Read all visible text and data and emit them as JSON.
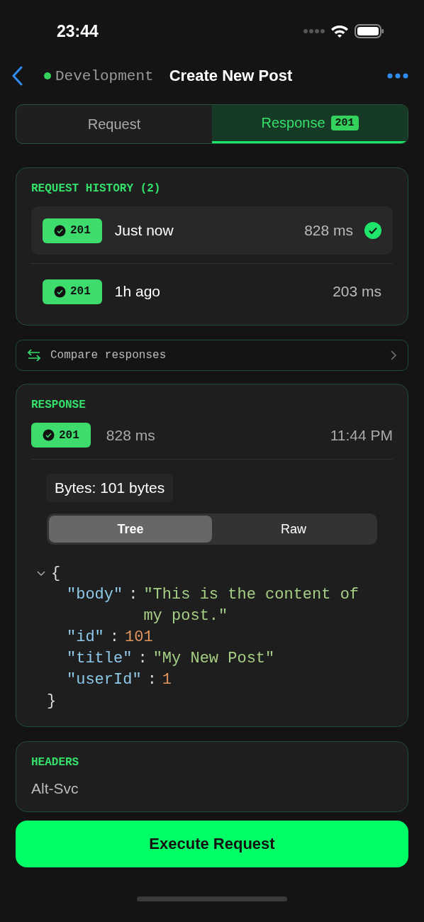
{
  "status_bar": {
    "time": "23:44"
  },
  "nav": {
    "environment": "Development",
    "title": "Create New Post"
  },
  "tabs": [
    {
      "label": "Request",
      "selected": false
    },
    {
      "label": "Response",
      "selected": true,
      "badge": "201"
    }
  ],
  "history": {
    "title": "REQUEST HISTORY (2)",
    "items": [
      {
        "status": "201",
        "time": "Just now",
        "duration": "828 ms",
        "selected": true
      },
      {
        "status": "201",
        "time": "1h ago",
        "duration": "203 ms",
        "selected": false
      }
    ]
  },
  "compare": {
    "label": "Compare responses"
  },
  "response": {
    "title": "RESPONSE",
    "status": "201",
    "duration": "828 ms",
    "time": "11:44 PM",
    "size": "Bytes: 101 bytes",
    "views": [
      {
        "label": "Tree",
        "selected": true
      },
      {
        "label": "Raw",
        "selected": false
      }
    ],
    "json": {
      "expanded": true,
      "open": "{",
      "close": "}",
      "fields": [
        {
          "key": "\"body\"",
          "separator": ":",
          "value": "\"This is the content of my post.\"",
          "kind": "string"
        },
        {
          "key": "\"id\"",
          "separator": ":",
          "value": "101",
          "kind": "number"
        },
        {
          "key": "\"title\"",
          "separator": ":",
          "value": "\"My New Post\"",
          "kind": "string"
        },
        {
          "key": "\"userId\"",
          "separator": ":",
          "value": "1",
          "kind": "number"
        }
      ]
    }
  },
  "headers": {
    "title": "HEADERS",
    "items": [
      {
        "name": "Alt-Svc"
      }
    ]
  },
  "action": "Execute Request"
}
